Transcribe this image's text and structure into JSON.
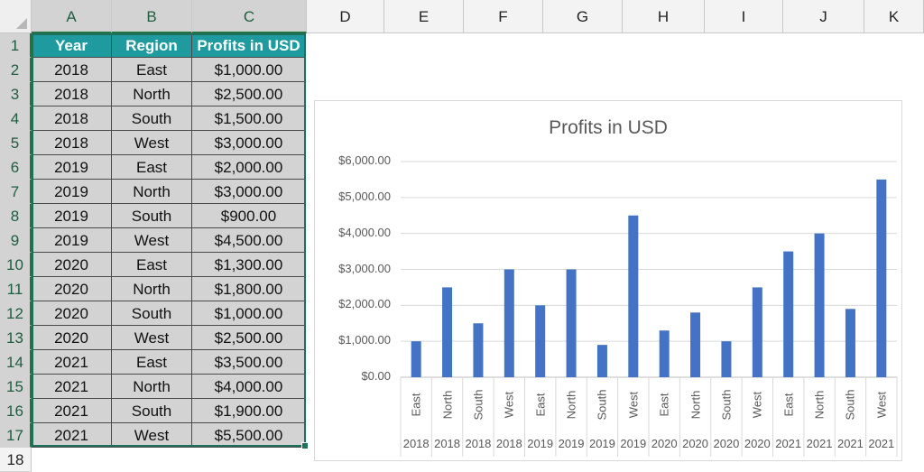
{
  "columns": [
    "A",
    "B",
    "C",
    "D",
    "E",
    "F",
    "G",
    "H",
    "I",
    "J",
    "K"
  ],
  "rows": [
    "1",
    "2",
    "3",
    "4",
    "5",
    "6",
    "7",
    "8",
    "9",
    "10",
    "11",
    "12",
    "13",
    "14",
    "15",
    "16",
    "17",
    "18"
  ],
  "table": {
    "headers": [
      "Year",
      "Region",
      "Profits in USD"
    ],
    "rows": [
      [
        "2018",
        "East",
        "$1,000.00"
      ],
      [
        "2018",
        "North",
        "$2,500.00"
      ],
      [
        "2018",
        "South",
        "$1,500.00"
      ],
      [
        "2018",
        "West",
        "$3,000.00"
      ],
      [
        "2019",
        "East",
        "$2,000.00"
      ],
      [
        "2019",
        "North",
        "$3,000.00"
      ],
      [
        "2019",
        "South",
        "$900.00"
      ],
      [
        "2019",
        "West",
        "$4,500.00"
      ],
      [
        "2020",
        "East",
        "$1,300.00"
      ],
      [
        "2020",
        "North",
        "$1,800.00"
      ],
      [
        "2020",
        "South",
        "$1,000.00"
      ],
      [
        "2020",
        "West",
        "$2,500.00"
      ],
      [
        "2021",
        "East",
        "$3,500.00"
      ],
      [
        "2021",
        "North",
        "$4,000.00"
      ],
      [
        "2021",
        "South",
        "$1,900.00"
      ],
      [
        "2021",
        "West",
        "$5,500.00"
      ]
    ]
  },
  "colors": {
    "header_fill": "#1f9ba0",
    "cell_fill": "#d3d3d3",
    "bar": "#4472c4",
    "selection": "#217346"
  },
  "chart_data": {
    "type": "bar",
    "title": "Profits in USD",
    "xlabel": "",
    "ylabel": "",
    "ylim": [
      0,
      6000
    ],
    "yticks": [
      "$0.00",
      "$1,000.00",
      "$2,000.00",
      "$3,000.00",
      "$4,000.00",
      "$5,000.00",
      "$6,000.00"
    ],
    "grid": true,
    "categories": [
      "East",
      "North",
      "South",
      "West",
      "East",
      "North",
      "South",
      "West",
      "East",
      "North",
      "South",
      "West",
      "East",
      "North",
      "South",
      "West"
    ],
    "groups": [
      "2018",
      "2019",
      "2020",
      "2021"
    ],
    "values": [
      1000,
      2500,
      1500,
      3000,
      2000,
      3000,
      900,
      4500,
      1300,
      1800,
      1000,
      2500,
      3500,
      4000,
      1900,
      5500
    ]
  }
}
